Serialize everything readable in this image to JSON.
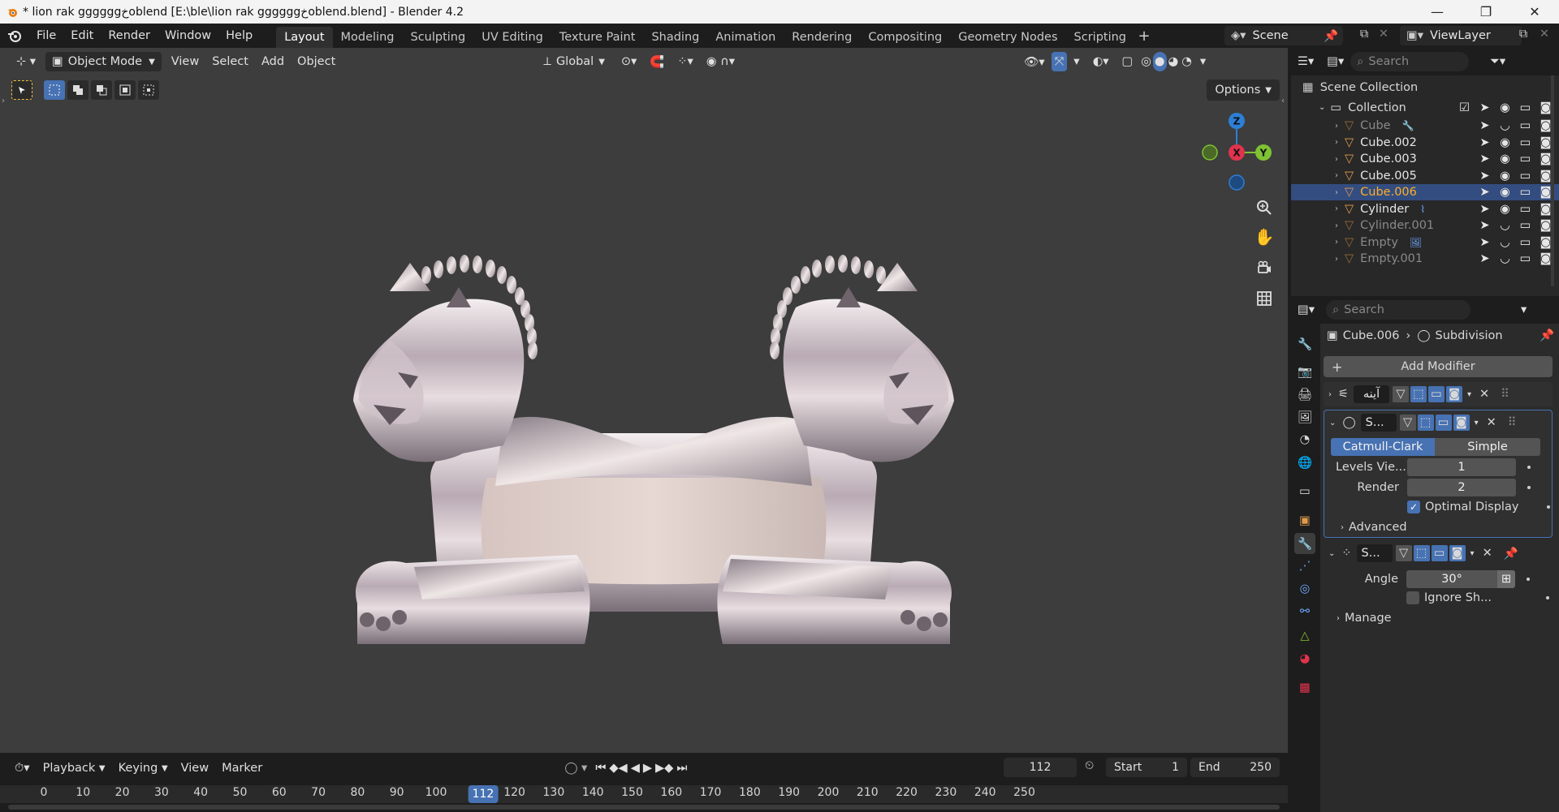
{
  "window": {
    "title": "* lion rak ggggggخoblend [E:\\ble\\lion rak ggggggخoblend.blend] - Blender 4.2",
    "minimize": "—",
    "maximize": "❐",
    "close": "✕"
  },
  "menu": {
    "file": "File",
    "edit": "Edit",
    "render": "Render",
    "window": "Window",
    "help": "Help"
  },
  "workspaces": [
    "Layout",
    "Modeling",
    "Sculpting",
    "UV Editing",
    "Texture Paint",
    "Shading",
    "Animation",
    "Rendering",
    "Compositing",
    "Geometry Nodes",
    "Scripting"
  ],
  "active_workspace": "Layout",
  "scene": {
    "name": "Scene",
    "view_layer": "ViewLayer"
  },
  "viewport": {
    "mode": "Object Mode",
    "menus": {
      "view": "View",
      "select": "Select",
      "add": "Add",
      "object": "Object"
    },
    "orientation": "Global",
    "options": "Options",
    "gizmo": {
      "z": "Z",
      "x": "X",
      "y": "Y"
    }
  },
  "timeline": {
    "menus": {
      "playback": "Playback",
      "keying": "Keying",
      "view": "View",
      "marker": "Marker"
    },
    "current_frame": "112",
    "start_label": "Start",
    "start": "1",
    "end_label": "End",
    "end": "250",
    "ticks": [
      "0",
      "10",
      "20",
      "30",
      "40",
      "50",
      "60",
      "70",
      "80",
      "90",
      "100",
      "120",
      "130",
      "140",
      "150",
      "160",
      "170",
      "180",
      "190",
      "200",
      "210",
      "220",
      "230",
      "240",
      "250"
    ],
    "tick_frames": [
      0,
      10,
      20,
      30,
      40,
      50,
      60,
      70,
      80,
      90,
      100,
      120,
      130,
      140,
      150,
      160,
      170,
      180,
      190,
      200,
      210,
      220,
      230,
      240,
      250
    ],
    "cursor_label": "112",
    "cursor_frame": 112
  },
  "outliner": {
    "search_placeholder": "Search",
    "scene_collection": "Scene Collection",
    "collection": "Collection",
    "items": [
      {
        "name": "Cube",
        "dim": true,
        "selected": false,
        "extra": "wrench"
      },
      {
        "name": "Cube.002",
        "dim": false,
        "selected": false,
        "extra": ""
      },
      {
        "name": "Cube.003",
        "dim": false,
        "selected": false,
        "extra": ""
      },
      {
        "name": "Cube.005",
        "dim": false,
        "selected": false,
        "extra": ""
      },
      {
        "name": "Cube.006",
        "dim": false,
        "selected": true,
        "extra": ""
      },
      {
        "name": "Cylinder",
        "dim": false,
        "selected": false,
        "extra": "curve"
      },
      {
        "name": "Cylinder.001",
        "dim": true,
        "selected": false,
        "extra": ""
      },
      {
        "name": "Empty",
        "dim": true,
        "selected": false,
        "extra": "image"
      },
      {
        "name": "Empty.001",
        "dim": true,
        "selected": false,
        "extra": ""
      }
    ]
  },
  "properties": {
    "search_placeholder": "Search",
    "object_name": "Cube.006",
    "modifier_crumb": "Subdivision",
    "add_modifier": "Add Modifier",
    "mod1_name": "آینه",
    "mod2_name": "S...",
    "catmull": "Catmull-Clark",
    "simple": "Simple",
    "levels_label": "Levels Vie...",
    "levels_value": "1",
    "render_label": "Render",
    "render_value": "2",
    "optimal_display": "Optimal Display",
    "advanced": "Advanced",
    "mod3_name": "S...",
    "angle_label": "Angle",
    "angle_value": "30°",
    "ignore_sharp": "Ignore Sh...",
    "manage": "Manage"
  },
  "colors": {
    "accent": "#4772b3",
    "selected_text": "#ffaf29",
    "object_orange": "#e09b4d",
    "axis_x": "#e0334d",
    "axis_y": "#7fc233",
    "axis_z": "#2d7fd6"
  }
}
